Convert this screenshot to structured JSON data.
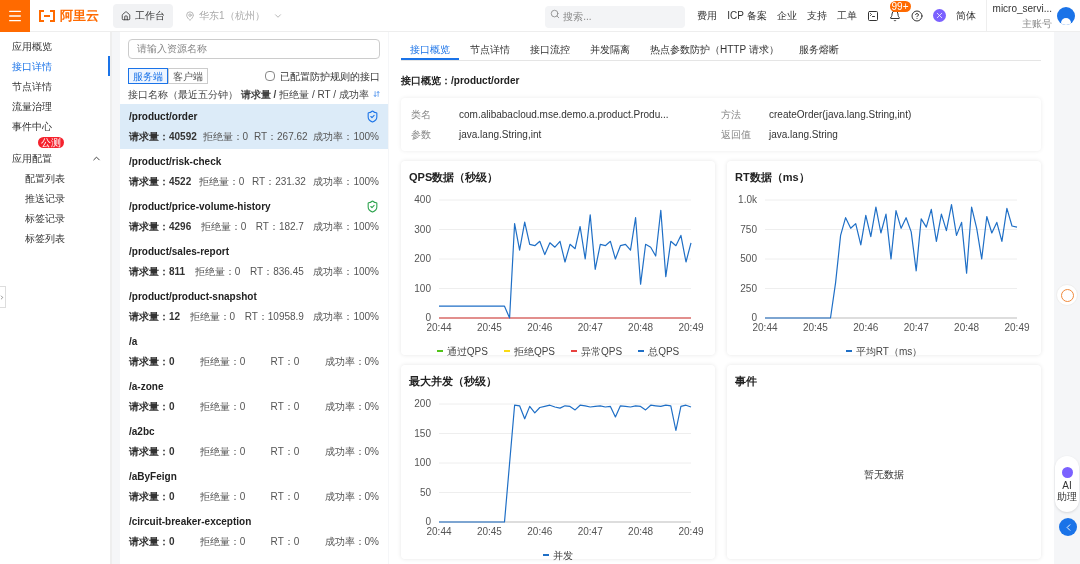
{
  "topbar": {
    "logo_text": "阿里云",
    "workbench": "工作台",
    "region": "华东1（杭州）",
    "search_placeholder": "搜索...",
    "links": [
      "费用",
      "ICP 备案",
      "企业",
      "支持",
      "工单"
    ],
    "notification_badge": "99+",
    "language": "简体",
    "account": {
      "name": "micro_servi...",
      "role": "主账号"
    }
  },
  "sidebar": {
    "items": [
      {
        "label": "应用概览",
        "selected": false
      },
      {
        "label": "接口详情",
        "selected": true
      },
      {
        "label": "节点详情",
        "selected": false
      },
      {
        "label": "流量治理",
        "selected": false
      },
      {
        "label": "事件中心",
        "selected": false
      },
      {
        "label": "应用配置",
        "selected": false,
        "badge": "公测",
        "expanded": true,
        "children": [
          {
            "label": "配置列表",
            "selected": false
          },
          {
            "label": "推送记录",
            "selected": false
          },
          {
            "label": "标签记录",
            "selected": false
          },
          {
            "label": "标签列表",
            "selected": false
          }
        ]
      }
    ]
  },
  "resources": {
    "search_placeholder": "请输入资源名称",
    "side_tabs": [
      {
        "label": "服务端",
        "selected": true
      },
      {
        "label": "客户端",
        "selected": false
      }
    ],
    "filter": {
      "label": "已配置防护规则的接口",
      "checked": false
    },
    "header": {
      "name": "接口名称",
      "metrics": "（最近五分钟） **请求量 /** 拒绝量 / RT / 成功率"
    },
    "rows": [
      {
        "name": "/product/order",
        "selected": true,
        "protected": true,
        "requests": "请求量：40592",
        "rejected": "拒绝量：0",
        "rt": "RT：267.62",
        "success": "成功率：100%"
      },
      {
        "name": "/product/risk-check",
        "selected": false,
        "protected": false,
        "requests": "请求量：4522",
        "rejected": "拒绝量：0",
        "rt": "RT：231.32",
        "success": "成功率：100%"
      },
      {
        "name": "/product/price-volume-history",
        "selected": false,
        "protected": true,
        "requests": "请求量：4296",
        "rejected": "拒绝量：0",
        "rt": "RT：182.7",
        "success": "成功率：100%"
      },
      {
        "name": "/product/sales-report",
        "selected": false,
        "protected": false,
        "requests": "请求量：811",
        "rejected": "拒绝量：0",
        "rt": "RT：836.45",
        "success": "成功率：100%"
      },
      {
        "name": "/product/product-snapshot",
        "selected": false,
        "protected": false,
        "requests": "请求量：12",
        "rejected": "拒绝量：0",
        "rt": "RT：10958.9",
        "success": "成功率：100%"
      },
      {
        "name": "/a",
        "selected": false,
        "protected": false,
        "requests": "请求量：0",
        "rejected": "拒绝量：0",
        "rt": "RT：0",
        "success": "成功率：0%"
      },
      {
        "name": "/a-zone",
        "selected": false,
        "protected": false,
        "requests": "请求量：0",
        "rejected": "拒绝量：0",
        "rt": "RT：0",
        "success": "成功率：0%"
      },
      {
        "name": "/a2bc",
        "selected": false,
        "protected": false,
        "requests": "请求量：0",
        "rejected": "拒绝量：0",
        "rt": "RT：0",
        "success": "成功率：0%"
      },
      {
        "name": "/aByFeign",
        "selected": false,
        "protected": false,
        "requests": "请求量：0",
        "rejected": "拒绝量：0",
        "rt": "RT：0",
        "success": "成功率：0%"
      },
      {
        "name": "/circuit-breaker-exception",
        "selected": false,
        "protected": false,
        "requests": "请求量：0",
        "rejected": "拒绝量：0",
        "rt": "RT：0",
        "success": "成功率：0%"
      }
    ]
  },
  "detail": {
    "tabs": [
      {
        "label": "接口概览",
        "selected": true
      },
      {
        "label": "节点详情",
        "selected": false
      },
      {
        "label": "接口流控",
        "selected": false
      },
      {
        "label": "并发隔离",
        "selected": false
      },
      {
        "label": "热点参数防护（HTTP 请求）",
        "selected": false
      },
      {
        "label": "服务熔断",
        "selected": false
      }
    ],
    "title": "接口概览：/product/order",
    "fields": [
      {
        "label": "类名",
        "value": "com.alibabacloud.mse.demo.a.product.Produ..."
      },
      {
        "label": "方法",
        "value": "createOrder(java.lang.String,int)"
      },
      {
        "label": "参数",
        "value": "java.lang.String,int"
      },
      {
        "label": "返回值",
        "value": "java.lang.String"
      }
    ],
    "panels": [
      {
        "kind": "chart",
        "chart_data": {
          "type": "line",
          "title": "QPS数据（秒级）",
          "categories": [
            "20:44",
            null,
            null,
            null,
            null,
            null,
            null,
            null,
            null,
            null,
            "20:45",
            null,
            null,
            null,
            null,
            null,
            null,
            null,
            null,
            null,
            "20:46",
            null,
            null,
            null,
            null,
            null,
            null,
            null,
            null,
            null,
            "20:47",
            null,
            null,
            null,
            null,
            null,
            null,
            null,
            null,
            null,
            "20:48",
            null,
            null,
            null,
            null,
            null,
            null,
            null,
            null,
            null,
            "20:49"
          ],
          "ylim": [
            0,
            400
          ],
          "yticks": [
            0,
            100,
            200,
            300,
            400
          ],
          "grid": true,
          "series": [
            {
              "name": "通过QPS",
              "color": "#52c41a",
              "values": [
                null,
                null,
                null,
                null,
                null,
                null,
                null,
                null,
                null,
                null,
                null,
                null,
                null,
                null,
                null,
                null,
                null,
                null,
                null,
                null,
                null,
                null,
                null,
                null,
                null,
                null,
                null,
                null,
                null,
                null,
                null,
                null,
                null,
                null,
                null,
                null,
                null,
                null,
                null,
                null,
                null,
                null,
                null,
                null,
                null,
                null,
                null,
                null,
                null,
                null,
                null
              ]
            },
            {
              "name": "拒绝QPS",
              "color": "#fadb14",
              "values": [
                null,
                null,
                null,
                null,
                null,
                null,
                null,
                null,
                null,
                null,
                null,
                null,
                null,
                null,
                null,
                null,
                null,
                null,
                null,
                null,
                null,
                null,
                null,
                null,
                null,
                null,
                null,
                null,
                null,
                null,
                null,
                null,
                null,
                null,
                null,
                null,
                null,
                null,
                null,
                null,
                null,
                null,
                null,
                null,
                null,
                null,
                null,
                null,
                null,
                null,
                null
              ]
            },
            {
              "name": "异常QPS",
              "color": "#e8423f",
              "values": [
                0,
                0,
                0,
                0,
                0,
                0,
                0,
                0,
                0,
                0,
                0,
                0,
                0,
                0,
                0,
                0,
                0,
                0,
                0,
                0,
                0,
                0,
                0,
                0,
                0,
                0,
                0,
                0,
                0,
                0,
                0,
                0,
                0,
                0,
                0,
                0,
                0,
                0,
                0,
                0,
                0,
                0,
                0,
                0,
                0,
                0,
                0,
                0,
                0,
                0,
                0
              ]
            },
            {
              "name": "总QPS",
              "color": "#1f6fc6",
              "values": [
                40,
                40,
                40,
                40,
                40,
                40,
                40,
                40,
                40,
                40,
                40,
                40,
                40,
                40,
                0,
                320,
                230,
                325,
                250,
                245,
                260,
                215,
                255,
                240,
                260,
                190,
                250,
                235,
                310,
                200,
                350,
                165,
                250,
                245,
                260,
                200,
                245,
                250,
                230,
                340,
                115,
                250,
                240,
                210,
                365,
                140,
                260,
                245,
                280,
                190,
                255
              ]
            }
          ]
        }
      },
      {
        "kind": "chart",
        "chart_data": {
          "type": "line",
          "title": "RT数据（ms）",
          "categories": [
            "20:44",
            null,
            null,
            null,
            null,
            null,
            null,
            null,
            null,
            null,
            "20:45",
            null,
            null,
            null,
            null,
            null,
            null,
            null,
            null,
            null,
            "20:46",
            null,
            null,
            null,
            null,
            null,
            null,
            null,
            null,
            null,
            "20:47",
            null,
            null,
            null,
            null,
            null,
            null,
            null,
            null,
            null,
            "20:48",
            null,
            null,
            null,
            null,
            null,
            null,
            null,
            null,
            null,
            "20:49"
          ],
          "ylim": [
            0,
            1000
          ],
          "yticks": [
            0,
            250,
            500,
            750,
            {
              "value": 1000,
              "label": "1.0k"
            }
          ],
          "grid": true,
          "series": [
            {
              "name": "平均RT（ms）",
              "color": "#1f6fc6",
              "values": [
                0,
                0,
                0,
                0,
                0,
                0,
                0,
                0,
                0,
                0,
                0,
                0,
                0,
                0,
                300,
                700,
                850,
                760,
                800,
                620,
                870,
                690,
                940,
                720,
                880,
                500,
                910,
                760,
                850,
                730,
                400,
                840,
                770,
                920,
                650,
                880,
                740,
                960,
                700,
                810,
                380,
                940,
                760,
                500,
                860,
                720,
                810,
                650,
                930,
                780,
                770
              ]
            }
          ]
        }
      },
      {
        "kind": "chart",
        "chart_data": {
          "type": "line",
          "title": "最大并发（秒级）",
          "categories": [
            "20:44",
            null,
            null,
            null,
            null,
            null,
            null,
            null,
            null,
            null,
            "20:45",
            null,
            null,
            null,
            null,
            null,
            null,
            null,
            null,
            null,
            "20:46",
            null,
            null,
            null,
            null,
            null,
            null,
            null,
            null,
            null,
            "20:47",
            null,
            null,
            null,
            null,
            null,
            null,
            null,
            null,
            null,
            "20:48",
            null,
            null,
            null,
            null,
            null,
            null,
            null,
            null,
            null,
            "20:49"
          ],
          "ylim": [
            0,
            200
          ],
          "yticks": [
            0,
            50,
            100,
            150,
            200
          ],
          "grid": true,
          "series": [
            {
              "name": "并发",
              "color": "#1f6fc6",
              "values": [
                0,
                0,
                0,
                0,
                0,
                0,
                0,
                0,
                0,
                0,
                0,
                0,
                0,
                0,
                100,
                198,
                197,
                175,
                196,
                185,
                194,
                196,
                198,
                195,
                193,
                197,
                196,
                190,
                198,
                197,
                195,
                196,
                197,
                195,
                196,
                178,
                197,
                196,
                195,
                197,
                196,
                190,
                198,
                197,
                196,
                198,
                197,
                155,
                196,
                198,
                195
              ]
            }
          ]
        }
      },
      {
        "kind": "events",
        "title": "事件",
        "empty": "暂无数据"
      }
    ]
  },
  "assistant": {
    "lines": [
      "AI",
      "助理"
    ]
  }
}
